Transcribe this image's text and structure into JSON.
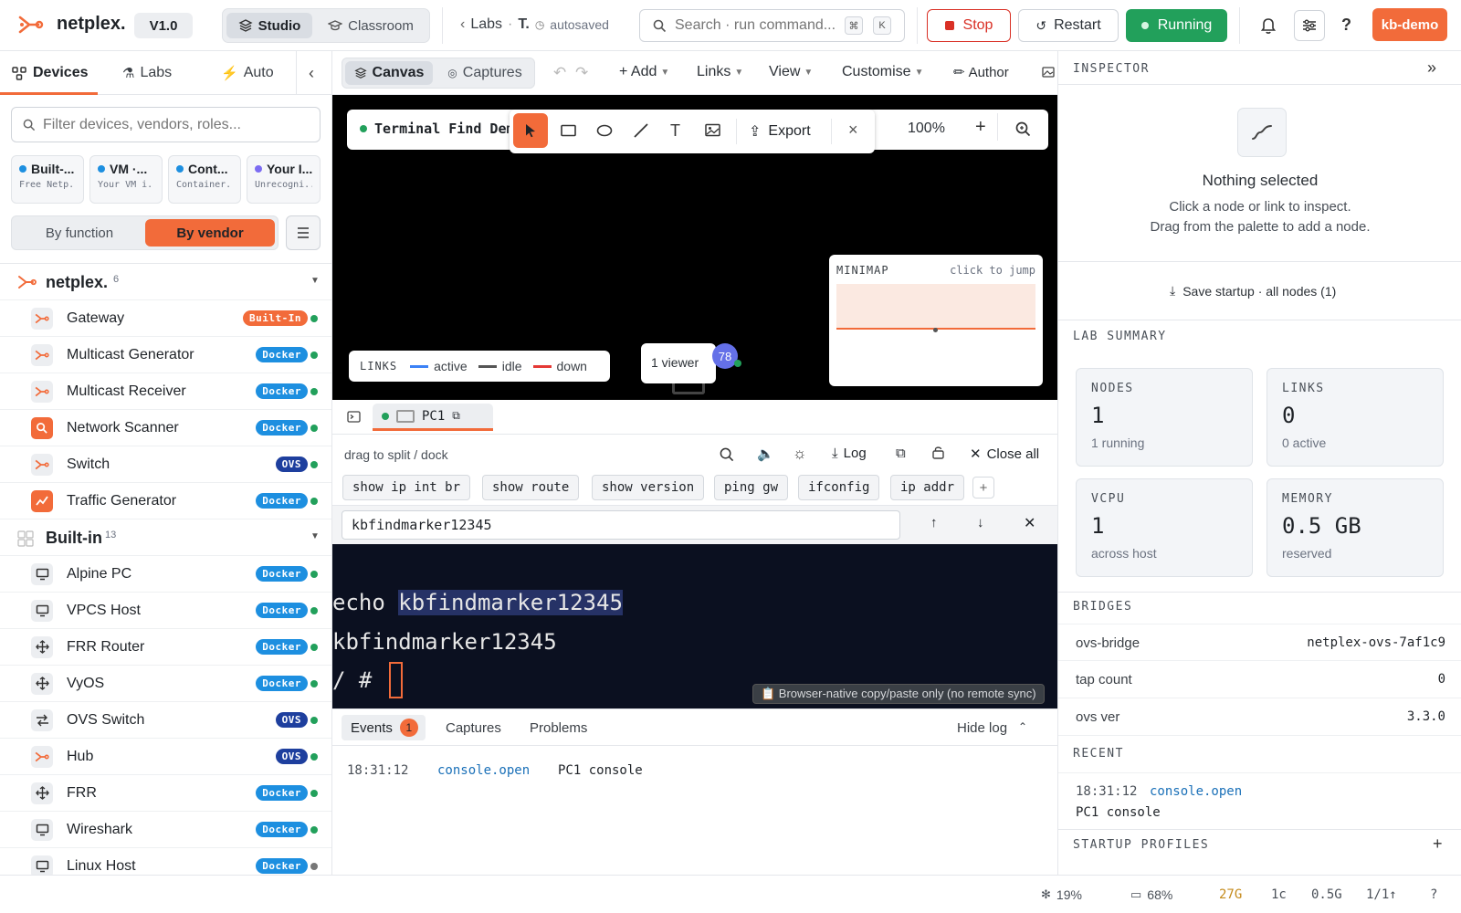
{
  "app": {
    "name": "netplex.",
    "version": "V1.0"
  },
  "modes": [
    {
      "label": "Studio",
      "active": true
    },
    {
      "label": "Classroom",
      "active": false
    }
  ],
  "breadcrumb": {
    "labs": "Labs",
    "sep": "·",
    "current": "T.",
    "save_status": "autosaved"
  },
  "search": {
    "placeholder": "Search · run command...",
    "kbd1": "⌘",
    "kbd2": "K"
  },
  "actions": {
    "stop": "Stop",
    "restart": "Restart",
    "running": "Running",
    "user": "kb-demo"
  },
  "colors": {
    "accent": "#f26b3a",
    "running": "#22a05b",
    "stop_border": "#d93025",
    "docker": "#1d8fe0",
    "ovs": "#1e3f9e"
  },
  "sidebar": {
    "tabs": [
      {
        "label": "Devices",
        "icon": "devices-icon"
      },
      {
        "label": "Labs",
        "icon": "flask-icon"
      },
      {
        "label": "Auto",
        "icon": "bolt-icon"
      }
    ],
    "filter_placeholder": "Filter devices, vendors, roles...",
    "sources": [
      {
        "title": "Built-...",
        "subtitle": "Free Netp...",
        "color": "#1d8fe0"
      },
      {
        "title": "VM ·...",
        "subtitle": "Your VM i...",
        "color": "#1d8fe0"
      },
      {
        "title": "Cont...",
        "subtitle": "Container...",
        "color": "#1d8fe0"
      },
      {
        "title": "Your I...",
        "subtitle": "Unrecogni...",
        "color": "#7c6cf2"
      }
    ],
    "group_by": {
      "by_function": "By function",
      "by_vendor": "By vendor"
    },
    "groups": [
      {
        "name": "netplex.",
        "count": "6",
        "items": [
          {
            "name": "Gateway",
            "badge": "Built-In",
            "type": "builtin",
            "icon": "netplex-logo-icon"
          },
          {
            "name": "Multicast Generator",
            "badge": "Docker",
            "type": "docker",
            "icon": "netplex-logo-icon"
          },
          {
            "name": "Multicast Receiver",
            "badge": "Docker",
            "type": "docker",
            "icon": "netplex-logo-icon"
          },
          {
            "name": "Network Scanner",
            "badge": "Docker",
            "type": "docker",
            "icon": "scanner-icon"
          },
          {
            "name": "Switch",
            "badge": "OVS",
            "type": "ovs",
            "icon": "netplex-logo-icon"
          },
          {
            "name": "Traffic Generator",
            "badge": "Docker",
            "type": "docker",
            "icon": "traffic-icon"
          }
        ]
      },
      {
        "name": "Built-in",
        "count": "13",
        "items": [
          {
            "name": "Alpine PC",
            "badge": "Docker",
            "type": "docker",
            "icon": "monitor-icon"
          },
          {
            "name": "VPCS Host",
            "badge": "Docker",
            "type": "docker",
            "icon": "monitor-icon"
          },
          {
            "name": "FRR Router",
            "badge": "Docker",
            "type": "docker",
            "icon": "router-icon"
          },
          {
            "name": "VyOS",
            "badge": "Docker",
            "type": "docker",
            "icon": "router-icon"
          },
          {
            "name": "OVS Switch",
            "badge": "OVS",
            "type": "ovs",
            "icon": "switch-arrows-icon"
          },
          {
            "name": "Hub",
            "badge": "OVS",
            "type": "ovs",
            "icon": "netplex-logo-icon"
          },
          {
            "name": "FRR",
            "badge": "Docker",
            "type": "docker",
            "icon": "router-icon"
          },
          {
            "name": "Wireshark",
            "badge": "Docker",
            "type": "docker",
            "icon": "monitor-icon"
          },
          {
            "name": "Linux Host",
            "badge": "Docker",
            "type": "docker",
            "icon": "monitor-icon"
          }
        ]
      }
    ]
  },
  "canvas_toolbar": {
    "tabs": [
      {
        "label": "Canvas",
        "active": true
      },
      {
        "label": "Captures",
        "active": false
      }
    ],
    "menus": [
      "+ Add",
      "Links",
      "View",
      "Customise",
      "Author"
    ]
  },
  "canvas": {
    "session_title": "Terminal Find Dem",
    "draw_tools": {
      "export": "Export"
    },
    "zoom": "100%",
    "links_legend": {
      "title": "LINKS",
      "active": "active",
      "idle": "idle",
      "down": "down"
    },
    "viewers": {
      "label": "1 viewer",
      "badge": "78"
    },
    "minimap": {
      "title": "MINIMAP",
      "hint": "click to jump"
    }
  },
  "terminal_panel": {
    "tab": {
      "label": "PC1"
    },
    "hint": "drag to split / dock",
    "log_btn": "Log",
    "close_all": "Close all",
    "quick_cmds": [
      "show ip int br",
      "show route",
      "show version",
      "ping gw",
      "ifconfig",
      "ip addr"
    ],
    "find_value": "kbfindmarker12345",
    "lines": {
      "cmd_prefix": "echo ",
      "cmd_match": "kbfindmarker12345",
      "output": "kbfindmarker12345",
      "prompt": "/ # "
    },
    "clipboard_note": "📋 Browser-native copy/paste only (no remote sync)"
  },
  "log": {
    "tabs": {
      "events": "Events",
      "events_count": "1",
      "captures": "Captures",
      "problems": "Problems"
    },
    "hide": "Hide log",
    "entries": [
      {
        "time": "18:31:12",
        "event": "console.open",
        "detail": "PC1 console"
      }
    ]
  },
  "inspector": {
    "title": "INSPECTOR",
    "empty_title": "Nothing selected",
    "empty_line1": "Click a node or link to inspect.",
    "empty_line2": "Drag from the palette to add a node.",
    "save_startup": "Save startup · all nodes (1)",
    "lab_summary_title": "LAB SUMMARY",
    "stats": [
      {
        "label": "NODES",
        "value": "1",
        "sub": "1 running"
      },
      {
        "label": "LINKS",
        "value": "0",
        "sub": "0 active"
      },
      {
        "label": "VCPU",
        "value": "1",
        "sub": "across host"
      },
      {
        "label": "MEMORY",
        "value": "0.5 GB",
        "sub": "reserved"
      }
    ],
    "bridges_title": "BRIDGES",
    "bridges": [
      {
        "key": "ovs-bridge",
        "value": "netplex-ovs-7af1c9"
      },
      {
        "key": "tap count",
        "value": "0"
      },
      {
        "key": "ovs ver",
        "value": "3.3.0"
      }
    ],
    "recent_title": "RECENT",
    "recent": {
      "time": "18:31:12",
      "event": "console.open",
      "detail": "PC1 console"
    },
    "startup_title": "STARTUP PROFILES"
  },
  "statusbar": {
    "cpu": "19%",
    "mem": "68%",
    "disk": "27G",
    "cores": "1c",
    "ram": "0.5G",
    "nodes": "1/1↑",
    "help": "?"
  }
}
